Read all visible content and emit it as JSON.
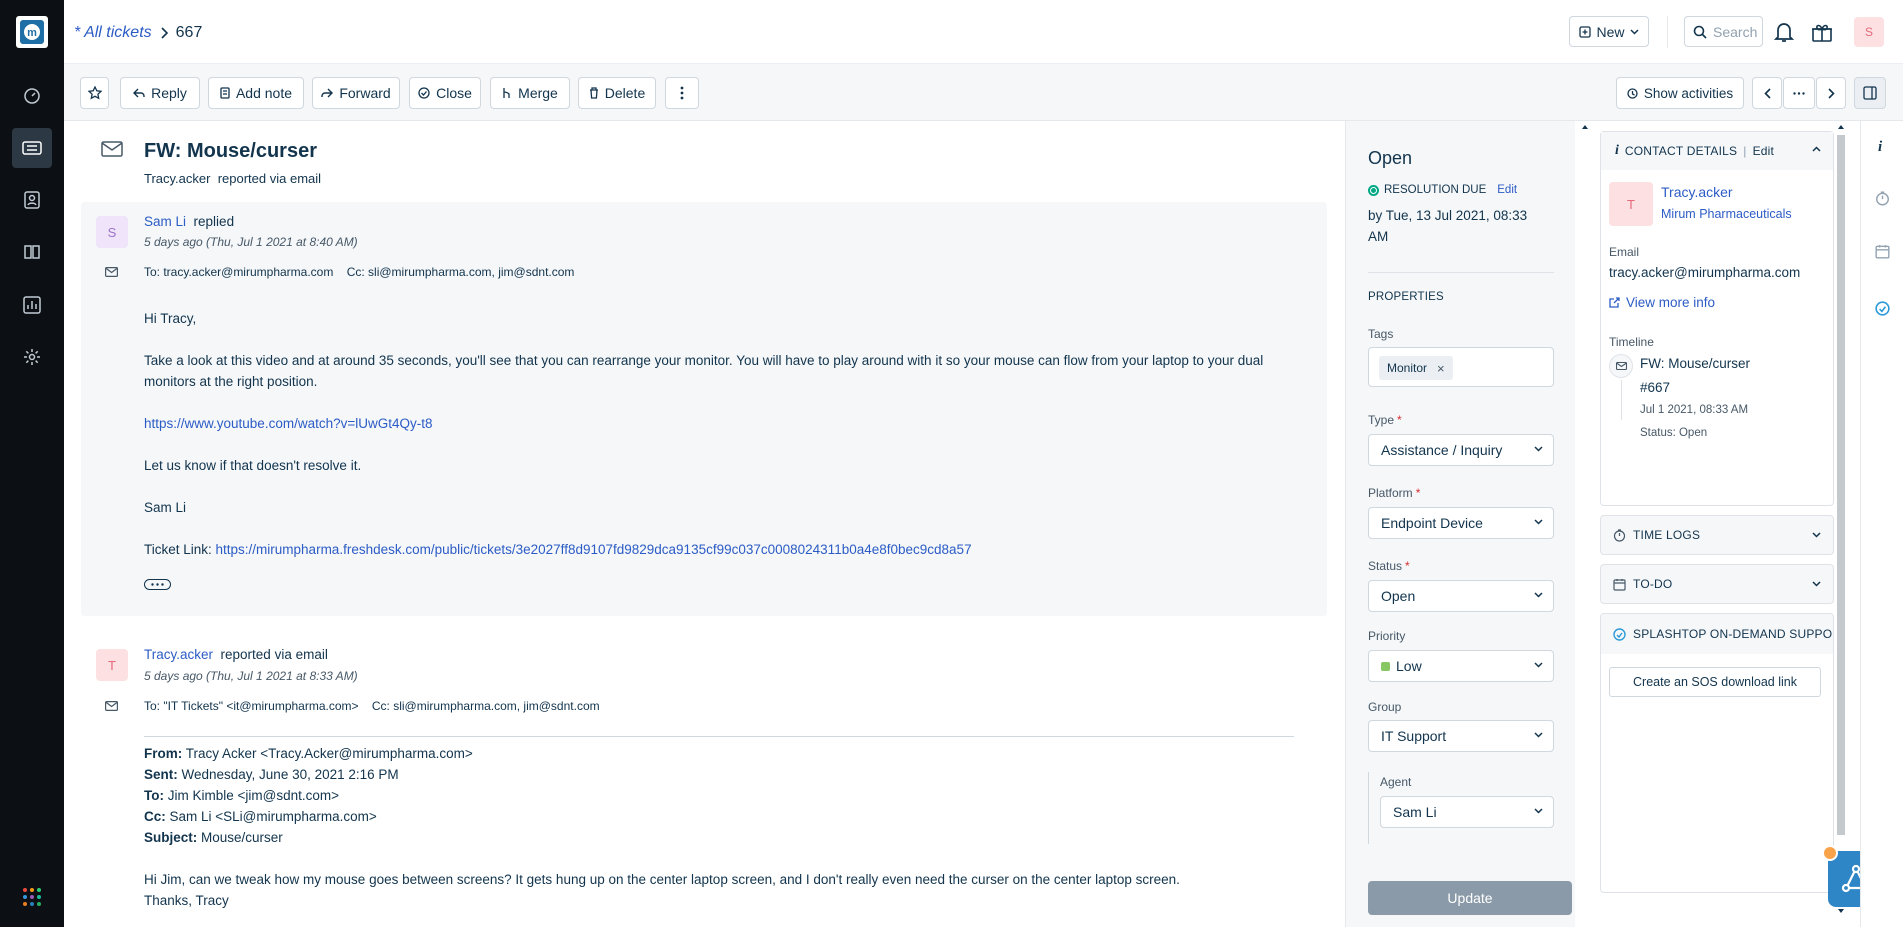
{
  "nav": {
    "items": [
      {
        "icon": "dashboard-icon"
      },
      {
        "icon": "tickets-icon"
      },
      {
        "icon": "contacts-icon"
      },
      {
        "icon": "solutions-icon"
      },
      {
        "icon": "reports-icon"
      },
      {
        "icon": "admin-gear-icon"
      }
    ],
    "apps_icon": "apps-grid-icon"
  },
  "header": {
    "breadcrumb_root": "* All tickets",
    "ticket_number": "667",
    "new_label": "New",
    "search_label": "Search",
    "user_initial": "S"
  },
  "toolbar": {
    "reply": "Reply",
    "add_note": "Add note",
    "forward": "Forward",
    "close": "Close",
    "merge": "Merge",
    "delete": "Delete",
    "show_activities": "Show activities"
  },
  "ticket": {
    "title": "FW: Mouse/curser",
    "requester": "Tracy.acker",
    "reported_via": "reported via email"
  },
  "messages": [
    {
      "initial": "S",
      "author": "Sam Li",
      "action": "replied",
      "time": "5 days ago (Thu, Jul 1 2021 at 8:40 AM)",
      "to": "To: tracy.acker@mirumpharma.com",
      "cc": "Cc: sli@mirumpharma.com, jim@sdnt.com",
      "greeting": "Hi Tracy,",
      "para1": "Take a look at this video and at around 35 seconds, you'll see that you can rearrange your monitor. You will have to play around with it so your mouse can flow from your laptop to your dual monitors at the right position.",
      "video_link": "https://www.youtube.com/watch?v=lUwGt4Qy-t8",
      "para2": "Let us know if that doesn't resolve it.",
      "signature": "Sam Li",
      "ticket_link_label": "Ticket Link: ",
      "ticket_link": "https://mirumpharma.freshdesk.com/public/tickets/3e2027ff8d9107fd9829dca9135cf99c037c0008024311b0a4e8f0bec9cd8a57"
    },
    {
      "initial": "T",
      "author": "Tracy.acker",
      "action": "reported via email",
      "time": "5 days ago (Thu, Jul 1 2021 at 8:33 AM)",
      "to": "To: \"IT Tickets\" <it@mirumpharma.com>",
      "cc": "Cc: sli@mirumpharma.com, jim@sdnt.com",
      "from_label": "From:",
      "from_value": " Tracy Acker <Tracy.Acker@mirumpharma.com>",
      "sent_label": "Sent:",
      "sent_value": " Wednesday, June 30, 2021 2:16 PM",
      "to_label": "To:",
      "to_value": " Jim Kimble <jim@sdnt.com>",
      "cc_label": "Cc:",
      "cc_value": " Sam Li <SLi@mirumpharma.com>",
      "subject_label": "Subject:",
      "subject_value": " Mouse/curser",
      "body": "Hi Jim, can we tweak how my mouse goes between screens? It gets hung up on the center laptop screen, and I don't really even need the curser on the center laptop screen.",
      "closing": "Thanks, Tracy"
    }
  ],
  "properties": {
    "status_heading": "Open",
    "resolution_label": "RESOLUTION DUE",
    "edit": "Edit",
    "due": "by Tue, 13 Jul 2021, 08:33 AM",
    "section": "PROPERTIES",
    "tags_label": "Tags",
    "tag": "Monitor",
    "type_label": "Type",
    "type_value": "Assistance / Inquiry",
    "platform_label": "Platform",
    "platform_value": "Endpoint Device",
    "status_label": "Status",
    "status_value": "Open",
    "priority_label": "Priority",
    "priority_value": "Low",
    "priority_color": "#87c764",
    "group_label": "Group",
    "group_value": "IT Support",
    "agent_label": "Agent",
    "agent_value": "Sam Li",
    "update": "Update"
  },
  "contact": {
    "section": "CONTACT DETAILS",
    "sep": "|",
    "edit": "Edit",
    "initial": "T",
    "name": "Tracy.acker",
    "company": "Mirum Pharmaceuticals",
    "email_label": "Email",
    "email": "tracy.acker@mirumpharma.com",
    "view_more": "View more info",
    "timeline_label": "Timeline",
    "tl_title": "FW: Mouse/curser",
    "tl_number": "#667",
    "tl_date": "Jul 1 2021, 08:33 AM",
    "tl_status": "Status: Open"
  },
  "apps": {
    "time_logs": "TIME LOGS",
    "todo": "TO-DO",
    "splashtop": "SPLASHTOP ON-DEMAND SUPPORT",
    "sos_button": "Create an SOS download link"
  }
}
